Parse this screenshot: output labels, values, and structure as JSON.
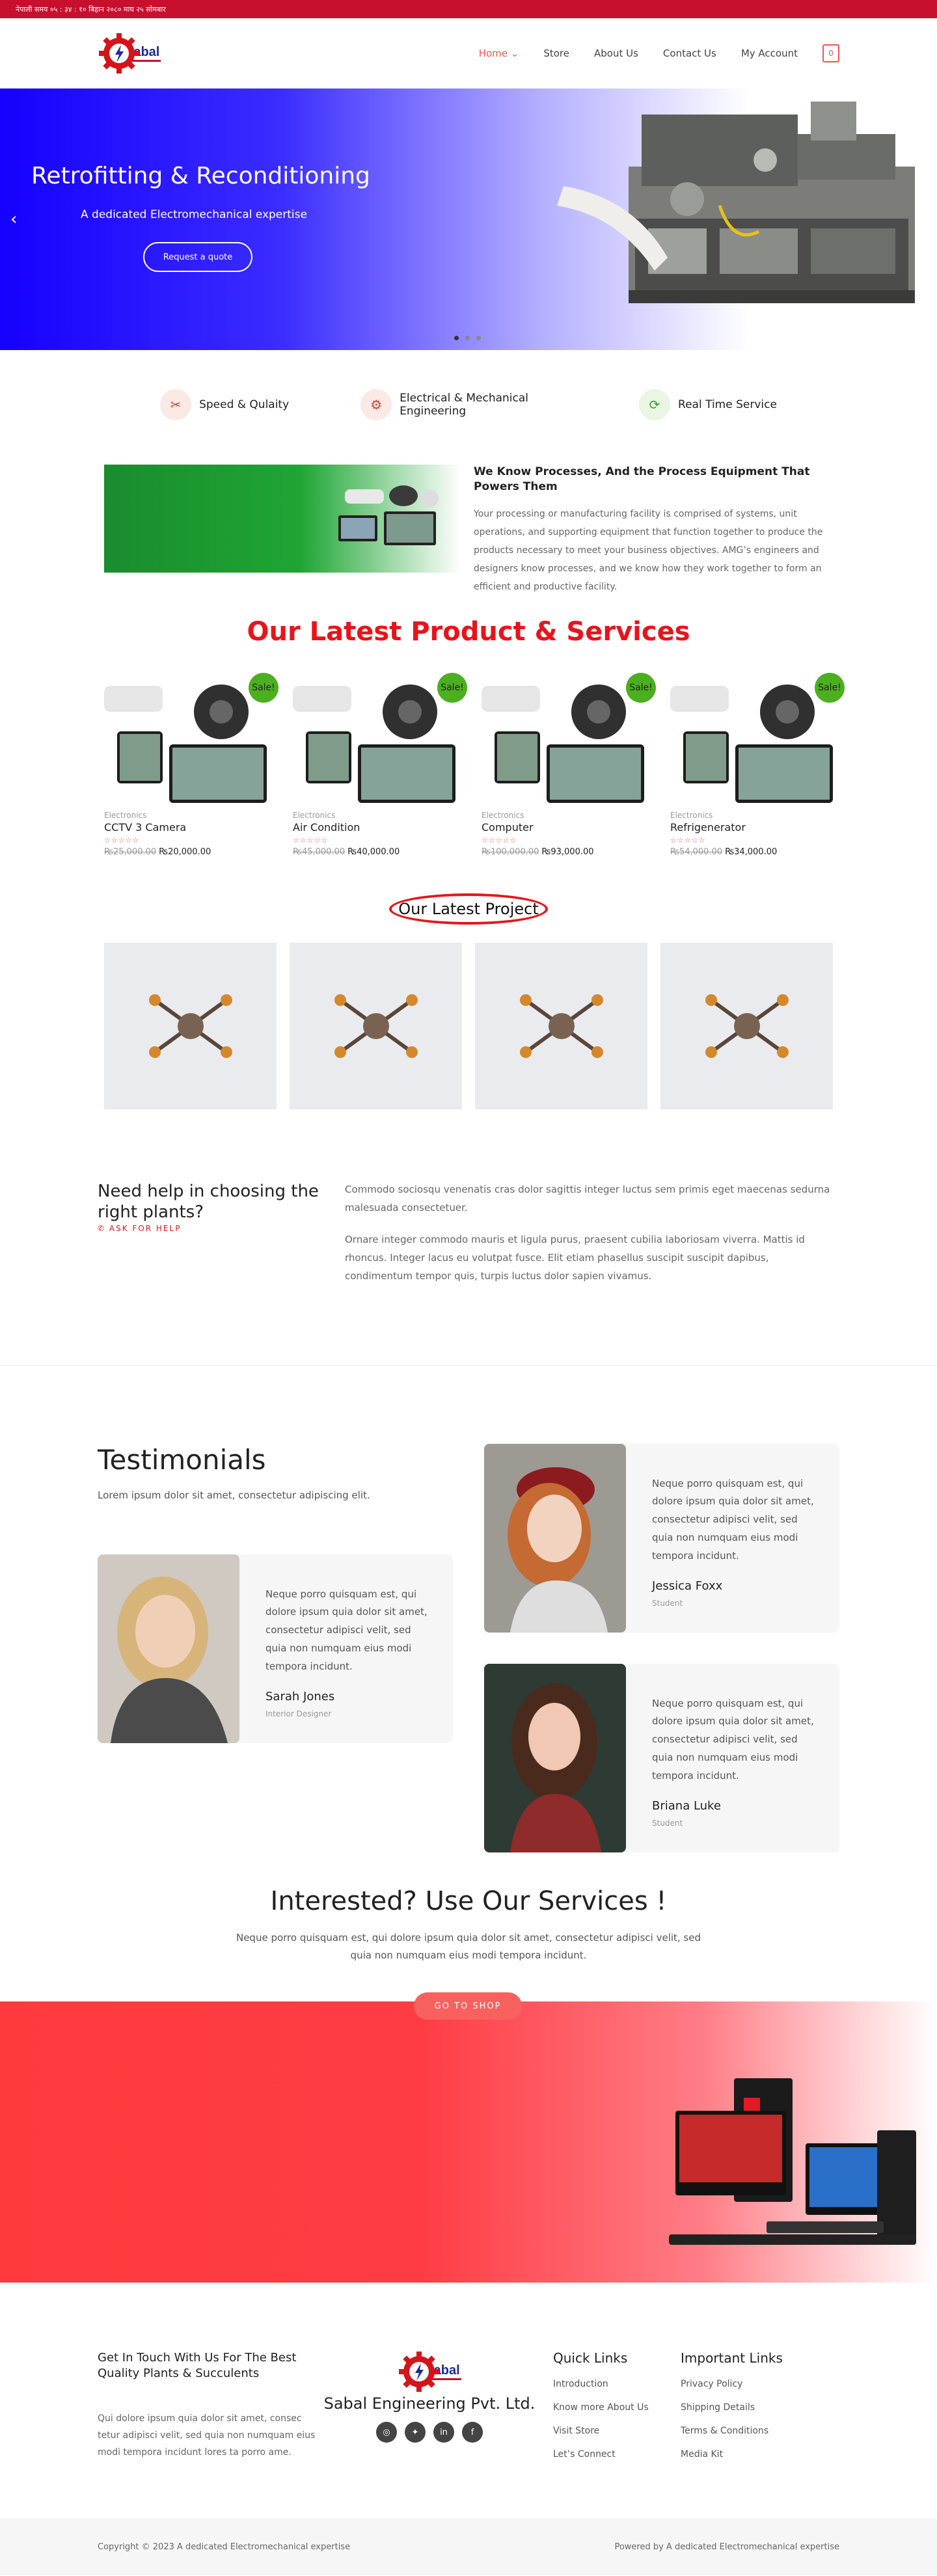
{
  "topbar": {
    "text": "नेपाली समय ०५ : ३४ : १० बिहान  २०८० माघ २५ सोमबार"
  },
  "header": {
    "logo_text": "Sabal",
    "nav": [
      {
        "label": "Home",
        "active": true
      },
      {
        "label": "Store"
      },
      {
        "label": "About Us"
      },
      {
        "label": "Contact Us"
      },
      {
        "label": "My Account"
      }
    ],
    "cart_count": "0",
    "accent": "#f0554e"
  },
  "hero": {
    "title": "Retrofitting & Reconditioning",
    "subtitle": "A dedicated Electromechanical expertise",
    "button": "Request a quote",
    "prev": "‹",
    "next": "›"
  },
  "features": [
    {
      "icon": "tools-icon",
      "label": "Speed & Qulaity"
    },
    {
      "icon": "gears-icon",
      "label_line1": "Electrical & Mechanical",
      "label_line2": "Engineering"
    },
    {
      "icon": "refresh-icon",
      "label": "Real Time Service"
    }
  ],
  "about": {
    "title": "We Know Processes, And the Process Equipment That Powers Them",
    "body": "Your processing or manufacturing facility is comprised of systems, unit operations, and supporting equipment that function together to produce the products necessary to meet your business objectives. AMG’s engineers and designers know processes, and we know how they work together to form an efficient and productive facility."
  },
  "products_section": {
    "title": "Our Latest Product & Services",
    "sale_label": "Sale!",
    "stars": "☆☆☆☆☆",
    "items": [
      {
        "category": "Electronics",
        "name": "CCTV 3 Camera",
        "old_price": "₨25,000.00",
        "price": "₨20,000.00"
      },
      {
        "category": "Electronics",
        "name": "Air Condition",
        "old_price": "₨45,000.00",
        "price": "₨40,000.00"
      },
      {
        "category": "Electronics",
        "name": "Computer",
        "old_price": "₨100,000.00",
        "price": "₨93,000.00"
      },
      {
        "category": "Electronics",
        "name": "Refrigenerator",
        "old_price": "₨54,000.00",
        "price": "₨34,000.00"
      }
    ]
  },
  "projects_section": {
    "title": "Our Latest Project"
  },
  "help": {
    "title": "Need help in choosing the right plants?",
    "ask": "ASK FOR HELP",
    "p1": "Commodo sociosqu venenatis cras dolor sagittis integer luctus sem primis eget maecenas sedurna malesuada consectetuer.",
    "p2": "Ornare integer commodo mauris et ligula purus, praesent cubilia laboriosam viverra. Mattis id rhoncus. Integer lacus eu volutpat fusce. Elit etiam phasellus suscipit suscipit dapibus, condimentum tempor quis, turpis luctus dolor sapien vivamus."
  },
  "testimonials": {
    "title": "Testimonials",
    "lead": "Lorem ipsum dolor sit amet, consectetur adipiscing elit.",
    "quote": "Neque porro quisquam est, qui dolore ipsum quia dolor sit amet, consectetur adipisci velit, sed quia non numquam eius modi tempora incidunt.",
    "people": [
      {
        "name": "Sarah Jones",
        "role": "Interior Designer"
      },
      {
        "name": "Jessica Foxx",
        "role": "Student"
      },
      {
        "name": "Briana Luke",
        "role": "Student"
      }
    ]
  },
  "interest": {
    "title": "Interested? Use Our Services !",
    "body": "Neque porro quisquam est, qui dolore ipsum quia dolor sit amet, consectetur adipisci velit, sed quia non numquam eius modi tempora incidunt.",
    "button": "GO TO SHOP"
  },
  "footer": {
    "contact_title": "Get In Touch With Us For The Best Quality Plants & Succulents",
    "contact_body": "Qui dolore ipsum quia dolor sit amet, consec tetur adipisci velit, sed quia non numquam eius modi tempora incidunt lores ta porro ame.",
    "brand": "Sabal Engineering Pvt. Ltd.",
    "social": [
      "◎",
      "✦",
      "in",
      "f"
    ],
    "quick_title": "Quick Links",
    "quick": [
      "Introduction",
      "Know more About Us",
      "Visit Store",
      "Let’s Connect"
    ],
    "important_title": "Important Links",
    "important": [
      "Privacy Policy",
      "Shipping Details",
      "Terms & Conditions",
      "Media Kit"
    ]
  },
  "bottom": {
    "copyright": "Copyright © 2023 A dedicated Electromechanical expertise",
    "powered": "Powered by A dedicated Electromechanical expertise"
  }
}
